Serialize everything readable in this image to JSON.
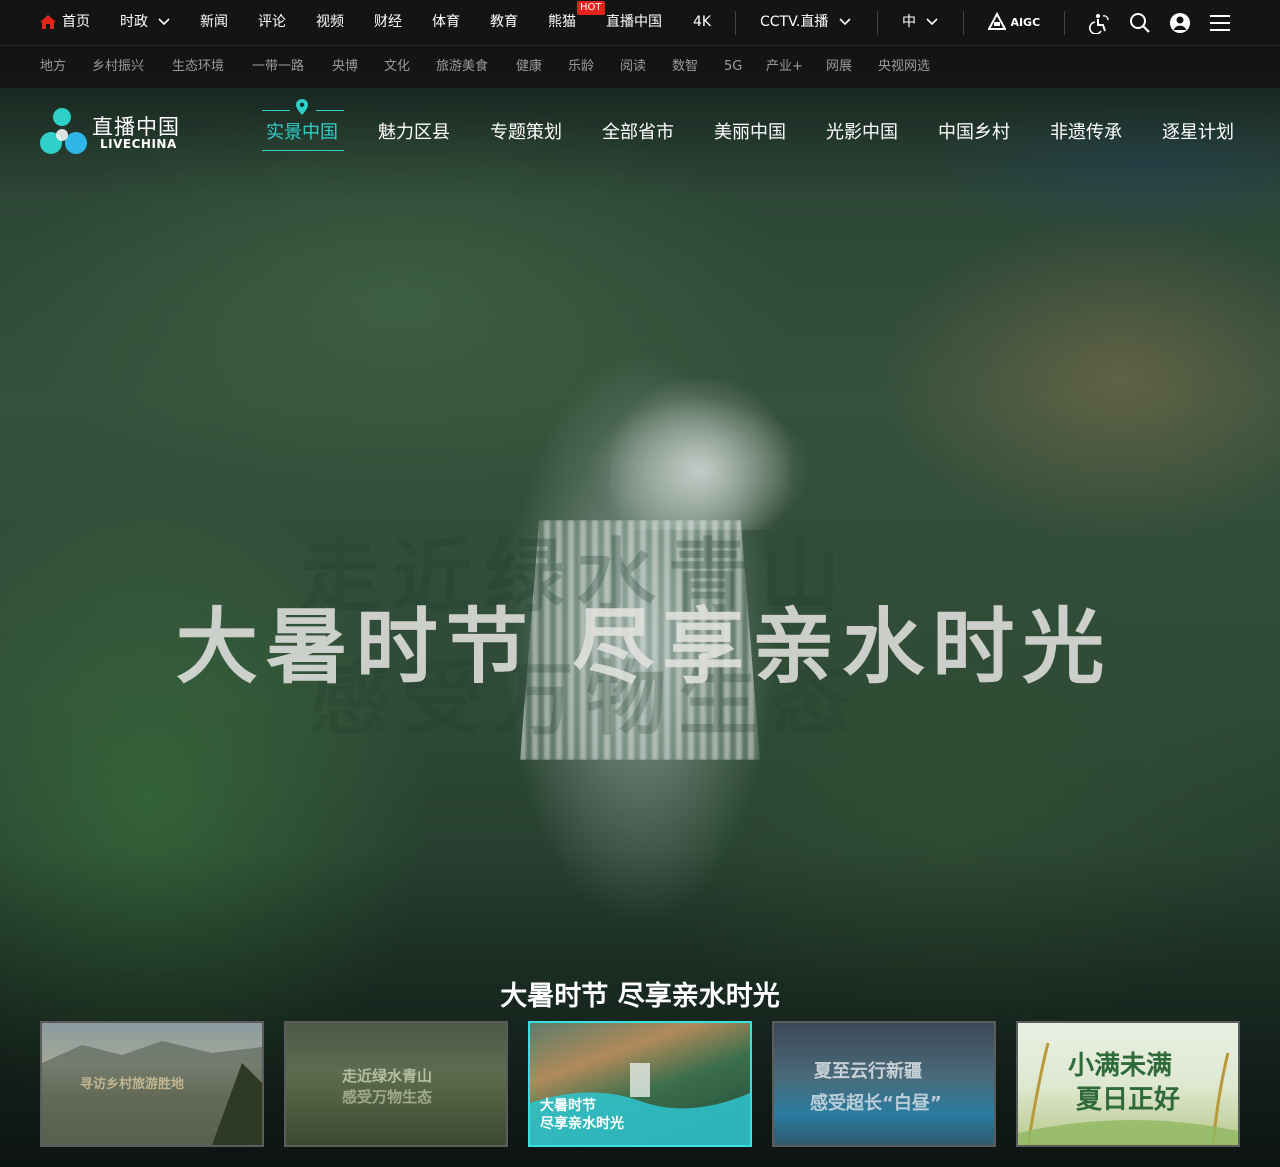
{
  "topbar": {
    "home": "首页",
    "items": [
      "时政",
      "新闻",
      "评论",
      "视频",
      "财经",
      "体育",
      "教育",
      "熊猫",
      "直播中国",
      "4K"
    ],
    "hot_badge": "HOT",
    "cctv": "CCTV.直播",
    "lang": "中",
    "aigc": "AIGC"
  },
  "subbar": {
    "items": [
      "地方",
      "乡村振兴",
      "生态环境",
      "一带一路",
      "央博",
      "文化",
      "旅游美食",
      "健康",
      "乐龄",
      "阅读",
      "数智",
      "5G",
      "产业+",
      "网展",
      "央视网选"
    ]
  },
  "logo": {
    "cn": "直播中国",
    "en": "LIVECHINA"
  },
  "mainnav": {
    "items": [
      "实景中国",
      "魅力区县",
      "专题策划",
      "全部省市",
      "美丽中国",
      "光影中国",
      "中国乡村",
      "非遗传承",
      "逐星计划"
    ],
    "active_index": 0
  },
  "hero": {
    "title": "大暑时节 尽享亲水时光",
    "ghost_line1": "走近绿水青山",
    "ghost_line2": "感受万物生态",
    "caption": "大暑时节 尽享亲水时光"
  },
  "thumbnails": [
    {
      "lines": [
        "寻访乡村旅游胜地"
      ],
      "active": false
    },
    {
      "lines": [
        "走近绿水青山",
        "感受万物生态"
      ],
      "active": false
    },
    {
      "lines": [
        "大暑时节",
        "尽享亲水时光"
      ],
      "active": true
    },
    {
      "lines": [
        "夏至云行新疆",
        "感受超长“白昼”"
      ],
      "active": false
    },
    {
      "lines": [
        "小满未满",
        "夏日正好"
      ],
      "active": false
    }
  ],
  "colors": {
    "accent": "#2fd0c8",
    "hot": "#e1251b",
    "active_thumb_border": "#38e0e0"
  }
}
